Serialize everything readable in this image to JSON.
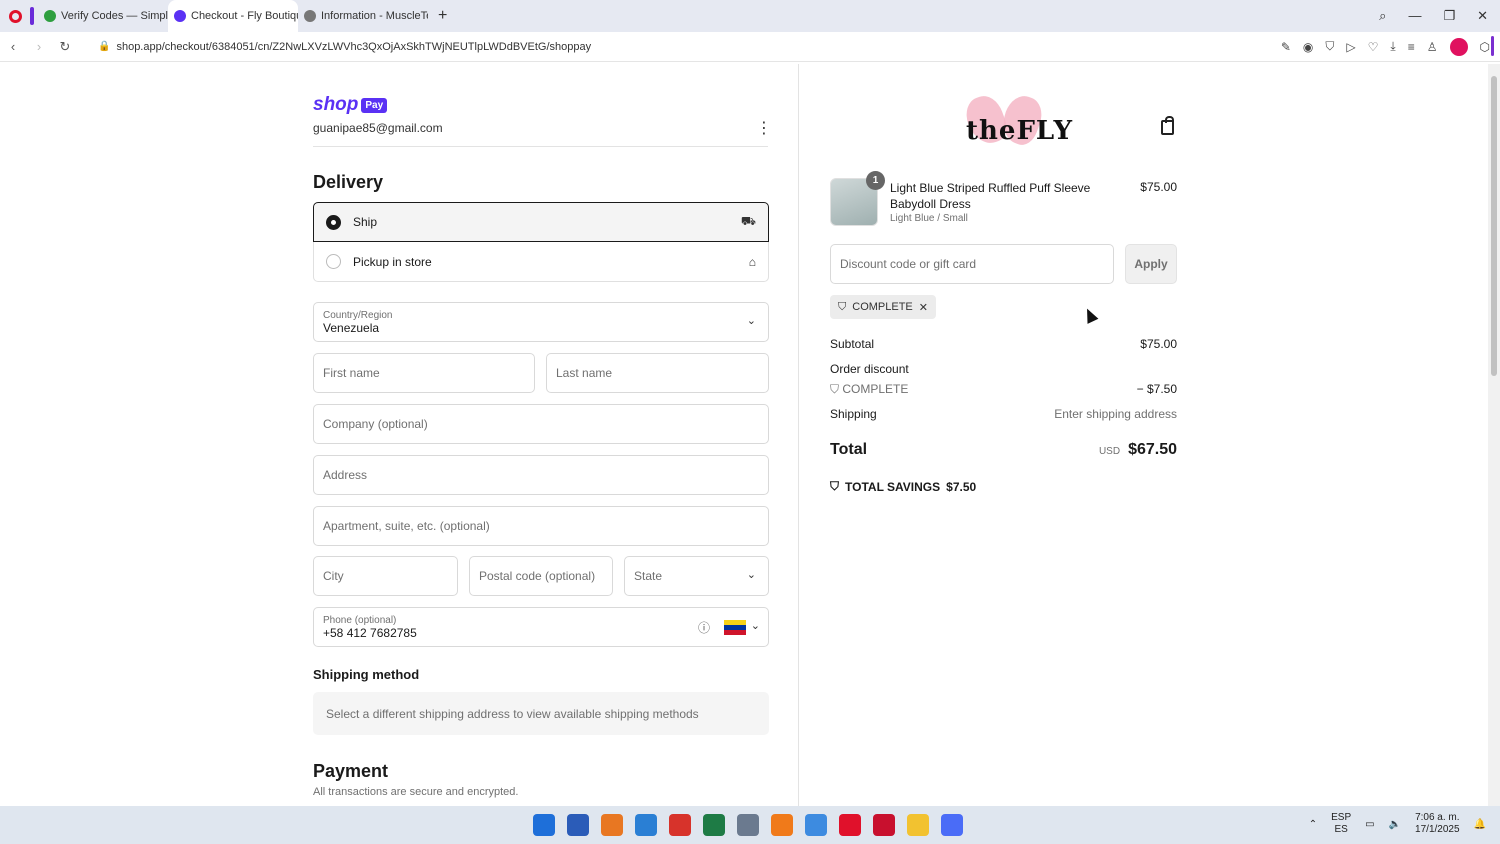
{
  "browser": {
    "tabs": [
      {
        "label": "Verify Codes — SimplyCo",
        "color": "#2e9e3f",
        "active": false
      },
      {
        "label": "Checkout - Fly Boutique",
        "color": "#5a31f4",
        "active": true
      },
      {
        "label": "Information - MuscleTech",
        "color": "#777777",
        "active": false
      }
    ],
    "url": "shop.app/checkout/6384051/cn/Z2NwLXVzLWVhc3QxOjAxSkhTWjNEUTlpLWDdBVEtG/shoppay"
  },
  "checkout": {
    "shop_word": "shop",
    "pay_badge": "Pay",
    "email": "guanipae85@gmail.com",
    "delivery_title": "Delivery",
    "ship_label": "Ship",
    "pickup_label": "Pickup in store",
    "country_label": "Country/Region",
    "country_value": "Venezuela",
    "first_name_placeholder": "First name",
    "last_name_placeholder": "Last name",
    "company_placeholder": "Company (optional)",
    "address_placeholder": "Address",
    "apartment_placeholder": "Apartment, suite, etc. (optional)",
    "city_placeholder": "City",
    "postal_placeholder": "Postal code (optional)",
    "state_placeholder": "State",
    "phone_label": "Phone (optional)",
    "phone_value": "+58 412 7682785",
    "shipping_method_title": "Shipping method",
    "shipping_method_message": "Select a different shipping address to view available shipping methods",
    "payment_title": "Payment",
    "payment_subtitle": "All transactions are secure and encrypted."
  },
  "summary": {
    "brand": "theFLY",
    "item": {
      "quantity": "1",
      "name": "Light Blue Striped Ruffled Puff Sleeve Babydoll Dress",
      "variant": "Light Blue / Small",
      "price": "$75.00"
    },
    "discount_placeholder": "Discount code or gift card",
    "apply_label": "Apply",
    "applied_code": "COMPLETE",
    "subtotal_label": "Subtotal",
    "subtotal_value": "$75.00",
    "order_discount_label": "Order discount",
    "discount_code": "COMPLETE",
    "discount_value": "− $7.50",
    "shipping_label": "Shipping",
    "shipping_value": "Enter shipping address",
    "total_label": "Total",
    "currency": "USD",
    "total_value": "$67.50",
    "savings_label": "TOTAL SAVINGS",
    "savings_value": "$7.50"
  },
  "taskbar": {
    "lang_top": "ESP",
    "lang_bottom": "ES",
    "time": "7:06 a. m.",
    "date": "17/1/2025",
    "app_colors": [
      "#1e6fd9",
      "#2b5cb8",
      "#e87722",
      "#2a7fd4",
      "#d7332b",
      "#1e7b45",
      "#6b7a8f",
      "#f07a1a",
      "#3d8be0",
      "#e0112b",
      "#c8102e",
      "#f2c230",
      "#4a6cf7"
    ]
  }
}
